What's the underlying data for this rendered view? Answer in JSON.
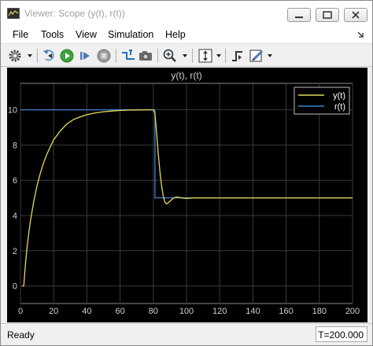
{
  "window": {
    "title": "Viewer: Scope (y(t), r(t))"
  },
  "menu": {
    "items": [
      "File",
      "Tools",
      "View",
      "Simulation",
      "Help"
    ]
  },
  "toolbar": {
    "buttons": [
      {
        "name": "settings",
        "icon": "gear-icon"
      },
      {
        "name": "step-back",
        "icon": "step-back-icon"
      },
      {
        "name": "run",
        "icon": "run-icon"
      },
      {
        "name": "step-forward",
        "icon": "step-forward-icon"
      },
      {
        "name": "stop",
        "icon": "stop-icon"
      },
      {
        "name": "highlight-signal",
        "icon": "highlight-icon"
      },
      {
        "name": "snapshot",
        "icon": "camera-icon"
      },
      {
        "name": "zoom",
        "icon": "zoom-icon"
      },
      {
        "name": "scale-axes",
        "icon": "scale-axes-icon"
      },
      {
        "name": "triggers",
        "icon": "triggers-icon"
      },
      {
        "name": "style",
        "icon": "style-icon"
      }
    ]
  },
  "plot": {
    "background": "#000000",
    "grid_color": "#3a3a3a",
    "axis_text_color": "#d0d0d0"
  },
  "status": {
    "text": "Ready",
    "time": "T=200.000"
  },
  "chart_data": {
    "type": "line",
    "title": "y(t), r(t)",
    "xlim": [
      0,
      200
    ],
    "ylim": [
      -1,
      11.5
    ],
    "xticks": [
      0,
      20,
      40,
      60,
      80,
      100,
      120,
      140,
      160,
      180,
      200
    ],
    "yticks": [
      0,
      2,
      4,
      6,
      8,
      10
    ],
    "grid": true,
    "legend_position": "top-right",
    "series": [
      {
        "name": "y(t)",
        "color": "#e6d85a",
        "x": [
          1,
          2,
          3,
          4,
          5,
          6,
          8,
          10,
          12,
          14,
          16,
          18,
          20,
          24,
          28,
          32,
          36,
          40,
          45,
          50,
          55,
          60,
          65,
          70,
          75,
          80,
          81,
          82,
          83,
          84,
          85,
          86,
          87,
          88,
          90,
          92,
          94,
          96,
          98,
          100,
          105,
          110,
          120,
          140,
          160,
          180,
          200
        ],
        "values": [
          0,
          0,
          1.2,
          2.2,
          3.0,
          3.7,
          4.8,
          5.7,
          6.4,
          7.0,
          7.5,
          7.9,
          8.3,
          8.8,
          9.2,
          9.45,
          9.6,
          9.72,
          9.82,
          9.89,
          9.93,
          9.96,
          9.98,
          9.99,
          10.0,
          10.0,
          9.8,
          8.7,
          7.5,
          6.5,
          5.7,
          5.1,
          4.75,
          4.65,
          4.8,
          4.98,
          5.05,
          5.02,
          4.98,
          4.97,
          5.0,
          5.0,
          5.0,
          5.0,
          5.0,
          5.0,
          5.0
        ]
      },
      {
        "name": "r(t)",
        "color": "#3f7fd4",
        "x": [
          0,
          81,
          81,
          200
        ],
        "values": [
          10,
          10,
          5,
          5
        ]
      }
    ]
  }
}
